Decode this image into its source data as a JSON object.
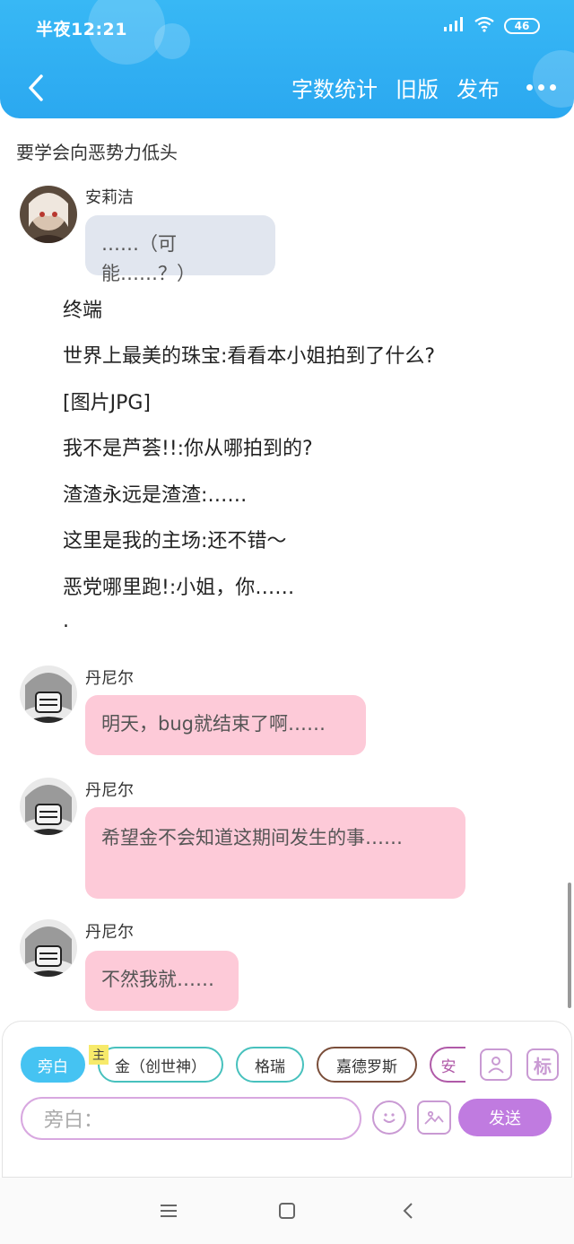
{
  "status": {
    "time": "半夜12:21",
    "battery": "46"
  },
  "nav": {
    "word_count": "字数统计",
    "old_version": "旧版",
    "publish": "发布"
  },
  "doc_title": "要学会向恶势力低头",
  "messages": [
    {
      "name": "安莉洁",
      "text": "……（可能……？）"
    },
    {
      "name": "丹尼尔",
      "text": "明天，bug就结束了啊……"
    },
    {
      "name": "丹尼尔",
      "text": "希望金不会知道这期间发生的事……"
    },
    {
      "name": "丹尼尔",
      "text": "不然我就……"
    }
  ],
  "narration": [
    "终端",
    "世界上最美的珠宝:看看本小姐拍到了什么?",
    "[图片JPG]",
    "我不是芦荟!!:你从哪拍到的?",
    "渣渣永远是渣渣:……",
    "这里是我的主场:还不错～",
    "恶党哪里跑!:小姐，你……",
    "."
  ],
  "chips": [
    {
      "label": "旁白",
      "style": "active"
    },
    {
      "label": "金（创世神）",
      "style": "teal"
    },
    {
      "label": "格瑞",
      "style": "teal"
    },
    {
      "label": "嘉德罗斯",
      "style": "brown"
    },
    {
      "label": "安",
      "style": "purple"
    }
  ],
  "main_tag": "主",
  "tag_tool_label": "标",
  "input": {
    "placeholder": "旁白："
  },
  "send_label": "发送",
  "colors": {
    "header": "#2ba8f0",
    "gray_bubble": "#e1e6ef",
    "pink_bubble": "#fdcad8",
    "send": "#c07be0"
  }
}
